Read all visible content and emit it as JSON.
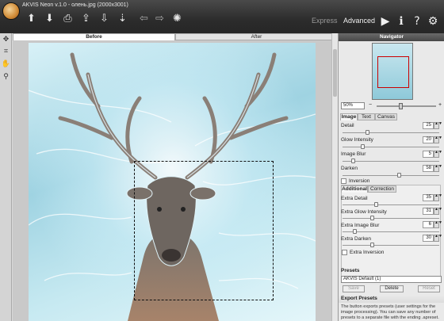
{
  "app": {
    "title": "AKVIS Neon v.1.0 - олень.jpg (2000x3001)"
  },
  "toolbar": {
    "icons": [
      "open-icon",
      "save-icon",
      "print-icon",
      "import-preset-icon",
      "export-preset-icon",
      "back-icon",
      "forward-icon",
      "run-icon"
    ],
    "mode_express": "Express",
    "mode_advanced": "Advanced",
    "right_icons": [
      "play-icon",
      "info-icon",
      "help-icon",
      "settings-icon"
    ]
  },
  "tools": [
    "hand-icon",
    "crop-icon",
    "pan-icon",
    "zoom-icon"
  ],
  "view_tabs": {
    "before": "Before",
    "after": "After"
  },
  "navigator": {
    "title": "Navigator",
    "zoom": "50%"
  },
  "params_tabs": {
    "image": "Image",
    "text": "Text",
    "canvas": "Canvas"
  },
  "params": [
    {
      "label": "Detail",
      "value": "25",
      "level": 0.25
    },
    {
      "label": "Glow Intensity",
      "value": "20",
      "level": 0.2
    },
    {
      "label": "Image Blur",
      "value": "5",
      "level": 0.1
    },
    {
      "label": "Darken",
      "value": "58",
      "level": 0.58
    }
  ],
  "inversion": {
    "label": "Inversion",
    "checked": false
  },
  "sub_tabs": {
    "additional": "Additional",
    "correction": "Correction"
  },
  "extra_params": [
    {
      "label": "Extra Detail",
      "value": "35",
      "level": 0.35
    },
    {
      "label": "Extra Glow Intensity",
      "value": "31",
      "level": 0.31
    },
    {
      "label": "Extra Image Blur",
      "value": "6",
      "level": 0.12
    },
    {
      "label": "Extra Darken",
      "value": "30",
      "level": 0.3
    }
  ],
  "extra_inversion": {
    "label": "Extra Inversion",
    "checked": false
  },
  "presets": {
    "title": "Presets",
    "selected": "AKVIS Default (1)",
    "save": "Save",
    "delete": "Delete",
    "reset": "Reset"
  },
  "export": {
    "title": "Export Presets",
    "text": "The button exports presets (user settings for the image processing). You can save any number of presets to a separate file with the ending .apreset."
  }
}
